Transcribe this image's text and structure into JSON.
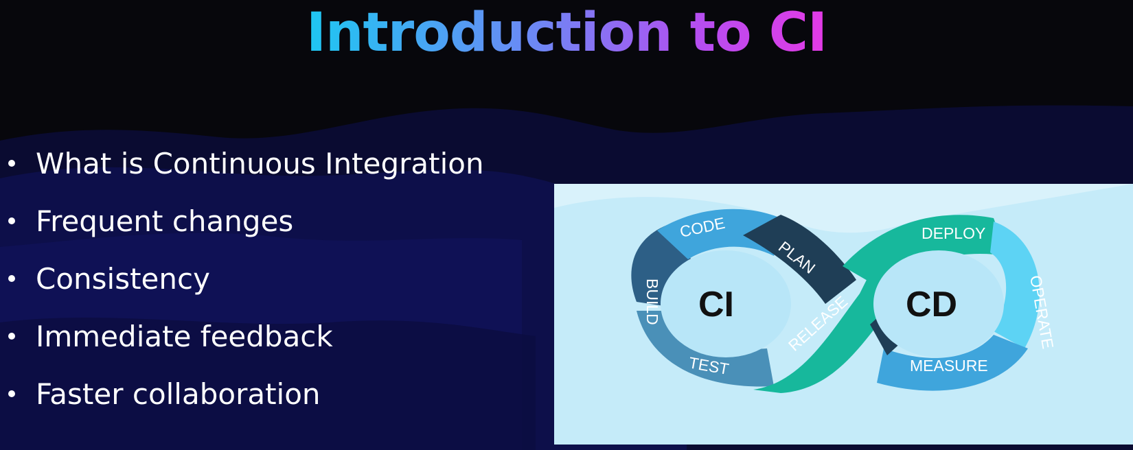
{
  "slide": {
    "title": "Introduction to CI"
  },
  "bullets": [
    "What is Continuous Integration",
    "Frequent changes",
    "Consistency",
    "Immediate feedback",
    "Faster collaboration"
  ],
  "diagram": {
    "left_label": "CI",
    "right_label": "CD",
    "stages": {
      "code": "CODE",
      "plan": "PLAN",
      "build": "BUILD",
      "test": "TEST",
      "release": "RELEASE",
      "deploy": "DEPLOY",
      "operate": "OPERATE",
      "measure": "MEASURE"
    }
  },
  "colors": {
    "title_gradient": [
      "#1ec7f2",
      "#6f86f5",
      "#e33ae6"
    ],
    "background": "#07070c",
    "wave": "#0d0f4a",
    "diagram_background": "#d9f2fb",
    "ci_blue": "#3fa5dc",
    "ci_dark": "#1f3e56",
    "cd_teal": "#17b89c",
    "cd_light": "#5dd3f4"
  }
}
